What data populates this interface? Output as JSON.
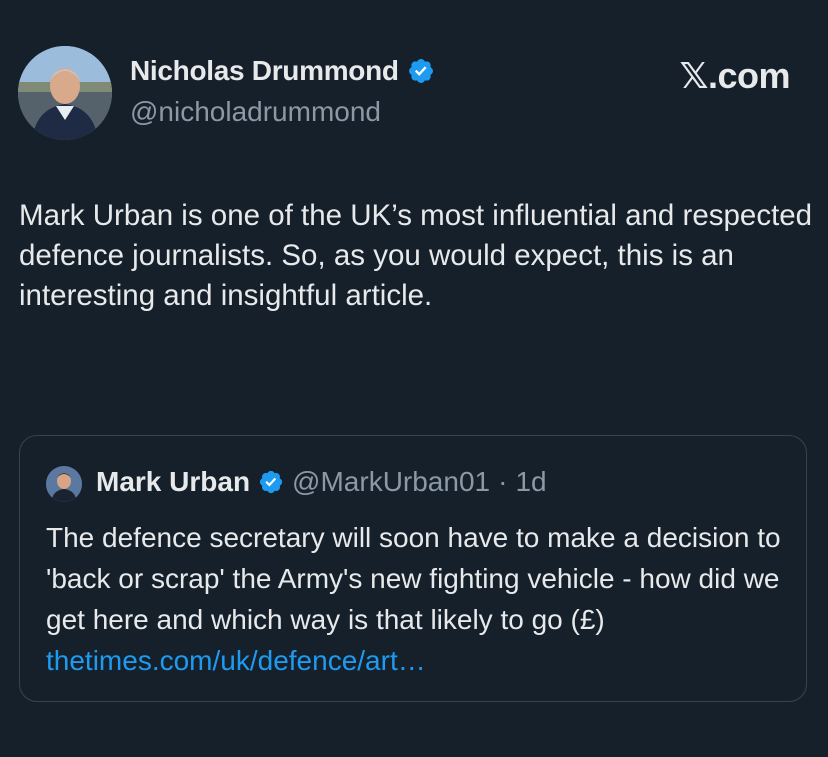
{
  "tweet": {
    "author": {
      "name": "Nicholas Drummond",
      "handle": "@nicholadrummond",
      "verified": true
    },
    "brand": "𝕏.com",
    "text": "Mark Urban is one of the UK’s most influential and respected defence journalists. So, as you would expect, this is an interesting and insightful article."
  },
  "quoted": {
    "author": {
      "name": "Mark Urban",
      "handle": "@MarkUrban01",
      "verified": true
    },
    "separator": "·",
    "time": "1d",
    "text": "The defence secretary will soon have to make a decision to 'back or scrap' the Army's new fighting vehicle - how did we get here and which way is that likely to go (£) ",
    "link": "thetimes.com/uk/defence/art…"
  },
  "colors": {
    "background": "#15202b",
    "text": "#e7e9ea",
    "muted": "#8b98a5",
    "link": "#1d9bf0",
    "verified_badge": "#1d9bf0",
    "border": "#38444d"
  },
  "icons": {
    "verified": "verified-badge-icon"
  }
}
